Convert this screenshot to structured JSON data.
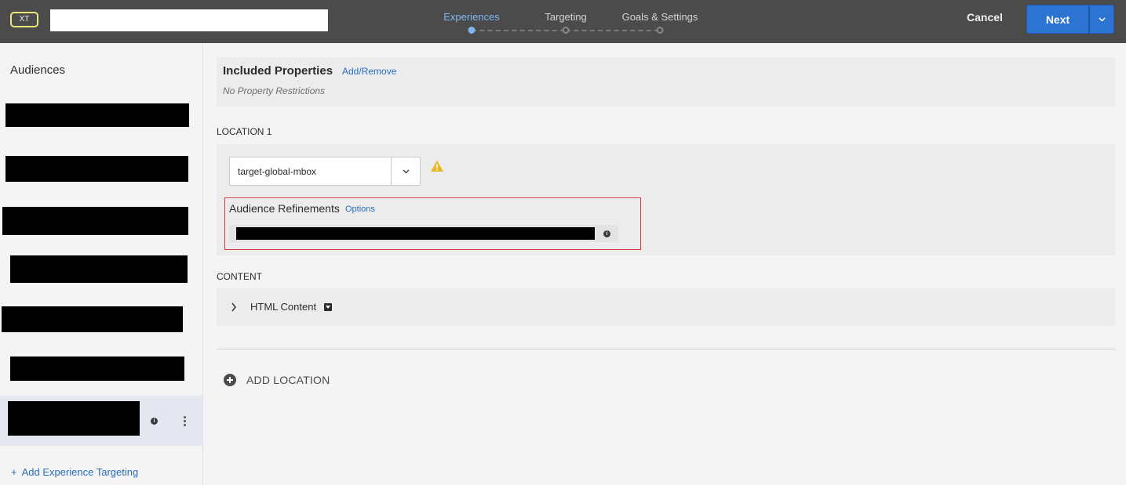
{
  "header": {
    "badge": "XT",
    "name_value": "",
    "steps": [
      {
        "label": "Experiences",
        "active": true
      },
      {
        "label": "Targeting",
        "active": false
      },
      {
        "label": "Goals & Settings",
        "active": false
      }
    ],
    "cancel_label": "Cancel",
    "next_label": "Next",
    "accent_color": "#2d74d2",
    "active_step_color": "#7fb6ee"
  },
  "sidebar": {
    "title": "Audiences",
    "items_redacted": true,
    "add_label": "Add Experience Targeting"
  },
  "properties": {
    "title": "Included Properties",
    "link": "Add/Remove",
    "subtitle": "No Property Restrictions"
  },
  "location": {
    "label": "LOCATION 1",
    "mbox_value": "target-global-mbox",
    "refinements_title": "Audience Refinements",
    "refinements_link": "Options",
    "warning_color": "#e8b923",
    "highlight_color": "#d7373f"
  },
  "content": {
    "label": "CONTENT",
    "item_label": "HTML Content"
  },
  "add_location_label": "ADD LOCATION"
}
